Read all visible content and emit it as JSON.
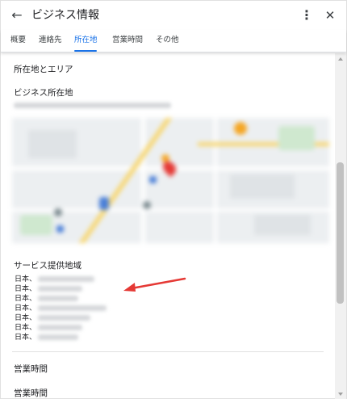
{
  "header": {
    "title": "ビジネス情報",
    "back_icon": "arrow-left-icon",
    "more_icon": "more-vert-icon",
    "close_icon": "close-icon"
  },
  "tabs": [
    {
      "label": "概要",
      "active": false
    },
    {
      "label": "連絡先",
      "active": false
    },
    {
      "label": "所在地",
      "active": true
    },
    {
      "label": "営業時間",
      "active": false
    },
    {
      "label": "その他",
      "active": false
    }
  ],
  "main": {
    "location_area_title": "所在地とエリア",
    "business_address_label": "ビジネス所在地",
    "service_area_title": "サービス提供地域",
    "service_areas": [
      "日本、",
      "日本、",
      "日本、",
      "日本、",
      "日本、",
      "日本、",
      "日本、"
    ],
    "hours_title_1": "営業時間",
    "hours_title_2": "営業時間"
  },
  "colors": {
    "accent": "#1a73e8",
    "annotation_arrow": "#e53935"
  }
}
